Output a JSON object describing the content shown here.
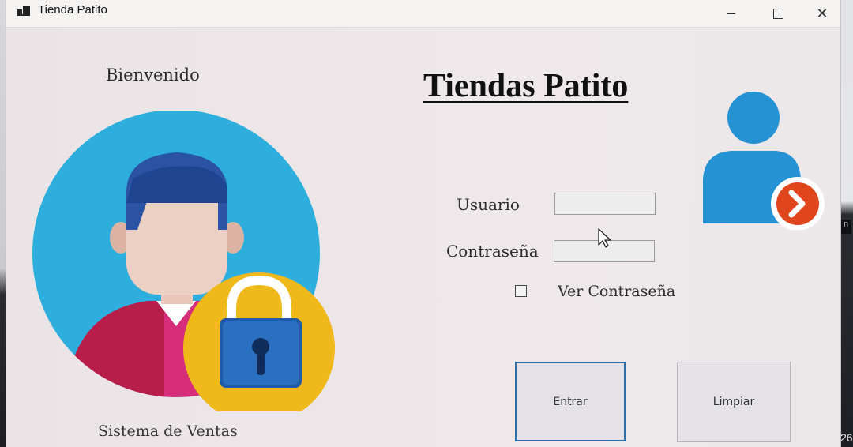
{
  "window": {
    "title": "Tienda Patito",
    "controls": {
      "minimize": "minimize",
      "maximize": "maximize",
      "close": "✕"
    }
  },
  "main": {
    "welcome_text": "Bienvenido",
    "brand_title": "Tiendas Patito",
    "footer_text": "Sistema de Ventas"
  },
  "form": {
    "username_label": "Usuario",
    "username_value": "",
    "password_label": "Contraseña",
    "password_value": "",
    "show_password_label": "Ver Contraseña",
    "show_password_checked": false,
    "enter_label": "Entrar",
    "clear_label": "Limpiar"
  },
  "desktop": {
    "side_marker": "n",
    "taskbar_text": "26"
  },
  "colors": {
    "accent_blue": "#2e6fa8",
    "hero_circle": "#2eaedc",
    "lock_ring": "#efb81b",
    "badge_orange": "#e0461b"
  },
  "icons": {
    "app": "app-window-icon",
    "hero": "user-lock-illustration",
    "badge": "user-login-icon",
    "cursor": "mouse-pointer-icon"
  }
}
